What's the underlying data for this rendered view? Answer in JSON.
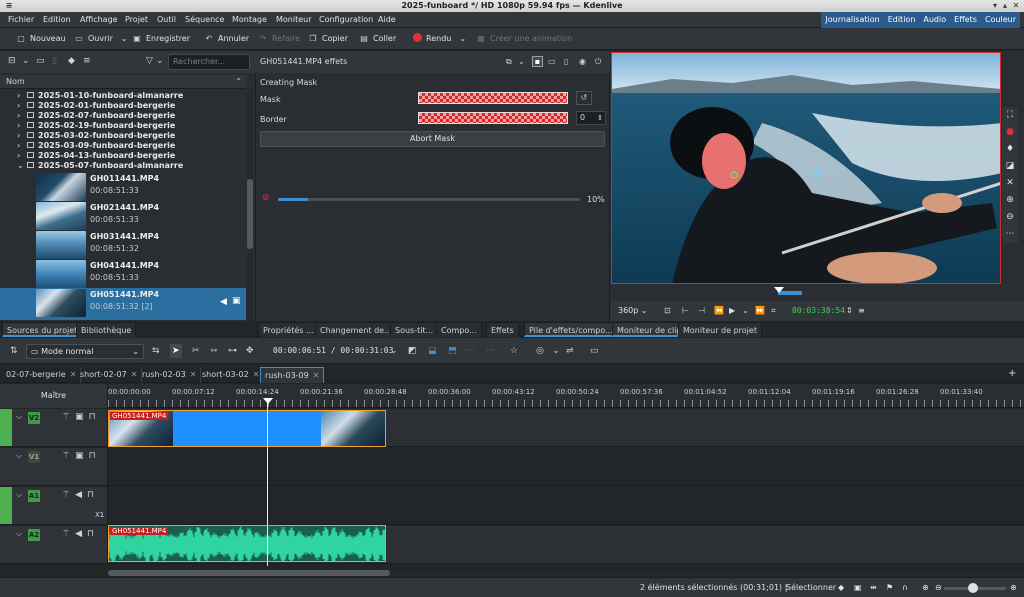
{
  "window": {
    "title": "2025-funboard */ HD 1080p 59.94 fps — Kdenlive"
  },
  "menu": [
    "Fichier",
    "Edition",
    "Affichage",
    "Projet",
    "Outil",
    "Séquence",
    "Montage",
    "Moniteur",
    "Configuration",
    "Aide"
  ],
  "layouts": [
    "Journalisation",
    "Edition",
    "Audio",
    "Effets",
    "Couleur"
  ],
  "toolbar": {
    "new_label": "Nouveau",
    "open_label": "Ouvrir",
    "save_label": "Enregistrer",
    "undo_label": "Annuler",
    "redo_label": "Refaire",
    "copy_label": "Copier",
    "paste_label": "Coller",
    "render_label": "Rendu",
    "animation_label": "Créer une animation"
  },
  "bin": {
    "search_placeholder": "Rechercher...",
    "column": "Nom",
    "folders": [
      "2025-01-10-funboard-almanarre",
      "2025-02-01-funboard-bergerie",
      "2025-02-07-funboard-bergerie",
      "2025-02-19-funboard-bergerie",
      "2025-03-02-funboard-bergerie",
      "2025-03-09-funboard-bergerie",
      "2025-04-13-funboard-bergerie",
      "2025-05-07-funboard-almanarre"
    ],
    "clips": [
      {
        "name": "GH011441.MP4",
        "duration": "00:08:51:33"
      },
      {
        "name": "GH021441.MP4",
        "duration": "00:08:51:33"
      },
      {
        "name": "GH031441.MP4",
        "duration": "00:08:51:32"
      },
      {
        "name": "GH041441.MP4",
        "duration": "00:08:51:33"
      },
      {
        "name": "GH051441.MP4",
        "duration": "00:08:51:32 [2]"
      }
    ]
  },
  "effects": {
    "title": "GH051441.MP4 effets",
    "section": "Creating Mask",
    "mask_label": "Mask",
    "border_label": "Border",
    "border_value": "0",
    "abort_label": "Abort Mask",
    "progress_percent": 10,
    "progress_text": "10%"
  },
  "monitor": {
    "resolution": "360p",
    "timecode": "00:03:38:54"
  },
  "dock_tabs_left": [
    "Sources du projet",
    "Bibliothèque"
  ],
  "dock_tabs_mid": [
    "Propriétés ...",
    "Changement de...",
    "Sous-tit...",
    "Compo...",
    "Effets",
    "Pile d'effets/compo..."
  ],
  "dock_tabs_right": [
    "Moniteur de clip",
    "Moniteur de projet"
  ],
  "timeline": {
    "mode": "Mode normal",
    "timecode": "00:00:06:51 / 00:00:31:03",
    "sequence_tabs": [
      "02-07-bergerie",
      "short-02-07",
      "rush-02-03",
      "short-03-02",
      "rush-03-09"
    ],
    "master_label": "Maître",
    "ruler": [
      "00:00:00:00",
      "00:00:07:12",
      "00:00:14:24",
      "00:00:21:36",
      "00:00:28:48",
      "00:00:36:00",
      "00:00:43:12",
      "00:00:50:24",
      "00:00:57:36",
      "00:01:04:52",
      "00:01:12:04",
      "00:01:19:16",
      "00:01:26:28",
      "00:01:33:40"
    ],
    "tracks": [
      "V2",
      "V1",
      "A1",
      "A2"
    ],
    "a1_extra": "X1",
    "clip_name": "GH051441.MP4"
  },
  "status": {
    "selection": "2 éléments sélectionnés (00:31;01) |",
    "select_label": "Sélectionner"
  }
}
